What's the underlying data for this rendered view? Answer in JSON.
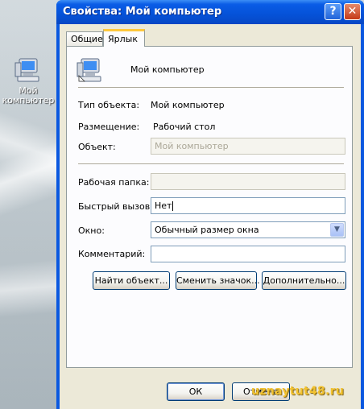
{
  "desktop": {
    "icon_label_line1": "Мой",
    "icon_label_line2": "компьютер",
    "icon": "my-computer-icon"
  },
  "window": {
    "title": "Свойства: Мой компьютер",
    "help_glyph": "?",
    "close_glyph": "✕"
  },
  "tabs": [
    {
      "label": "Общие",
      "active": false
    },
    {
      "label": "Ярлык",
      "active": true
    }
  ],
  "shortcut": {
    "name": "Мой компьютер",
    "icon": "my-computer-icon",
    "type_label": "Тип объекта:",
    "type_value": "Мой компьютер",
    "location_label": "Размещение:",
    "location_value": "Рабочий стол",
    "target_label": "Объект:",
    "target_value": "Мой компьютер",
    "workdir_label": "Рабочая папка:",
    "workdir_value": "",
    "hotkey_label": "Быстрый вызов:",
    "hotkey_value": "Нет",
    "window_label": "Окно:",
    "window_value": "Обычный размер окна",
    "comment_label": "Комментарий:",
    "comment_value": ""
  },
  "buttons": {
    "find_target": "Найти объект...",
    "change_icon": "Сменить значок...",
    "advanced": "Дополнительно...",
    "ok": "ОК",
    "cancel": "Отмена"
  },
  "watermark": "uznaytut48.ru",
  "colors": {
    "titlebar": "#0552d8",
    "tab_highlight": "#ffc83c",
    "dialog_bg": "#ece9d8"
  }
}
